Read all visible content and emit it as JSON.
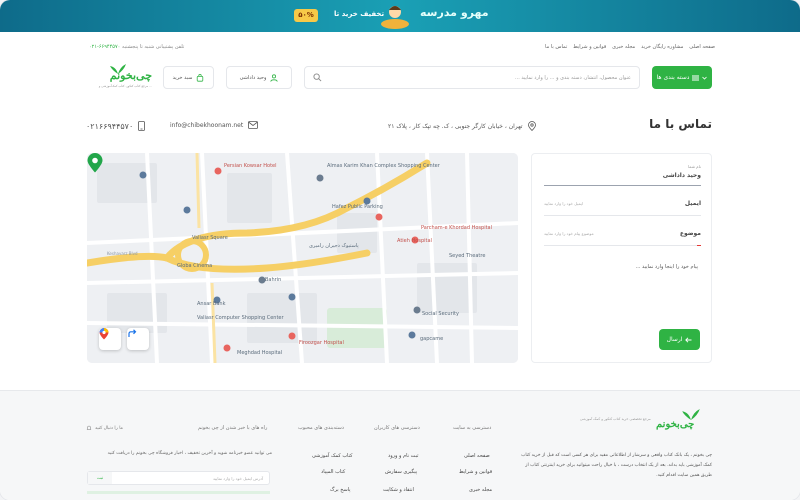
{
  "banner": {
    "brand": "مهرو مدرسه",
    "text": "تخفیف خرید تا",
    "badge": "۵۰%"
  },
  "top_links": [
    "صفحه اصلی",
    "مشاوره رایگان خرید",
    "مجله خبری",
    "قوانین و شرایط",
    "تماس با ما"
  ],
  "support": {
    "label": "تلفن پشتیبانی شنبه تا پنجشنبه",
    "phone": "۰۲۱-۶۶۹۴۴۵۷۰"
  },
  "header": {
    "category_button": "دسته بندی ها",
    "search_placeholder": "عنوان محصول، انتشار، دسته بندی و ... را وارد نمایید ...",
    "login_label": "وحید داداشی",
    "cart_label": "سبد خرید",
    "logo_text": "چی‌بخونم",
    "logo_tagline": "مرجع کتاب کنکور، کتاب کمک‌آموزشی و ..."
  },
  "contact": {
    "title": "تماس با ما",
    "address": "تهران ، خیابان کارگر جنوبی ، ک. چه تپک کار ، پلاک ۲۱",
    "email": "info@chibekhoonam.net",
    "phone": "۰۲۱۶۶۹۴۴۵۷۰"
  },
  "form": {
    "name_label": "نام شما",
    "name_value": "وحید داداشی",
    "email_label": "ایمیل",
    "email_placeholder": "ایمیل خود را وارد نمایید",
    "subject_label": "موضوع",
    "subject_placeholder": "موضوع پیام خود را وارد نمایید",
    "message_placeholder": "پیام خود را اینجا وارد نمایید ...",
    "send_button": "ارسال"
  },
  "map": {
    "labels": [
      "Persian Kowsar Hotel",
      "Almas Karim Khan Complex Shopping Center",
      "Hafez Public Parking",
      "Parcham-e Khordad Hospital",
      "Atieh Hospital",
      "Seyed Theatre",
      "Mosalla Ave",
      "Valiasr Square",
      "Globa Cinema",
      "Bahrin",
      "Ansar Bank",
      "Valiasr Computer Shopping Center",
      "Firoozgar Hospital",
      "Meghdad Hospital",
      "Social Security",
      "gapcame",
      "Tehran Shiraz",
      "Shirazi St",
      "Keshavarz Blvd",
      "Valiasr St",
      "Hafez",
      "پاستیوک دجیران رامیری"
    ],
    "pin_icon": "map-pin-icon",
    "maps_icon": "google-maps-icon",
    "directions_icon": "directions-icon"
  },
  "footer": {
    "logo_text": "چی‌بخونم",
    "tagline": "مرجع تخصصی خرید کتاب کنکور و کمک آموزشی",
    "about": "چی بخونم ، یک بانک کتاب واقعی و سرشار از اطلاعاتی مفید برای هر کسی است که قبل از خرید کتاب کمک آموزشی باید بداند. بعد از یک انتخاب درست ، با خیال راحت میتوانید برای خرید اینترنتی کتاب از طریق همین سایت اقدام کنید.",
    "columns": [
      {
        "title": "دسترسی به سایت",
        "links": [
          "صفحه اصلی",
          "قوانین و شرایط",
          "مجله خبری"
        ]
      },
      {
        "title": "دسترسی های کاربران",
        "links": [
          "ثبت نام و ورود",
          "پیگیری سفارش",
          "انتقاد و شکایت"
        ]
      },
      {
        "title": "دسته‌بندی های محبوب",
        "links": [
          "کتاب کمک آموزشی",
          "کتاب المپیاد",
          "پاسخ برگ"
        ]
      }
    ],
    "newsletter": {
      "title": "راه های با خبر شدن از چی بخونم",
      "text": "می توانید عضو خبرنامه شوید و آخرین تخفیف ، اخبار فروشگاه چی بخونم را دریافت کنید",
      "placeholder": "آدرس ایمیل خود را وارد نمایید",
      "submit": "ثبت"
    },
    "social": "ما را دنبال کنید"
  }
}
